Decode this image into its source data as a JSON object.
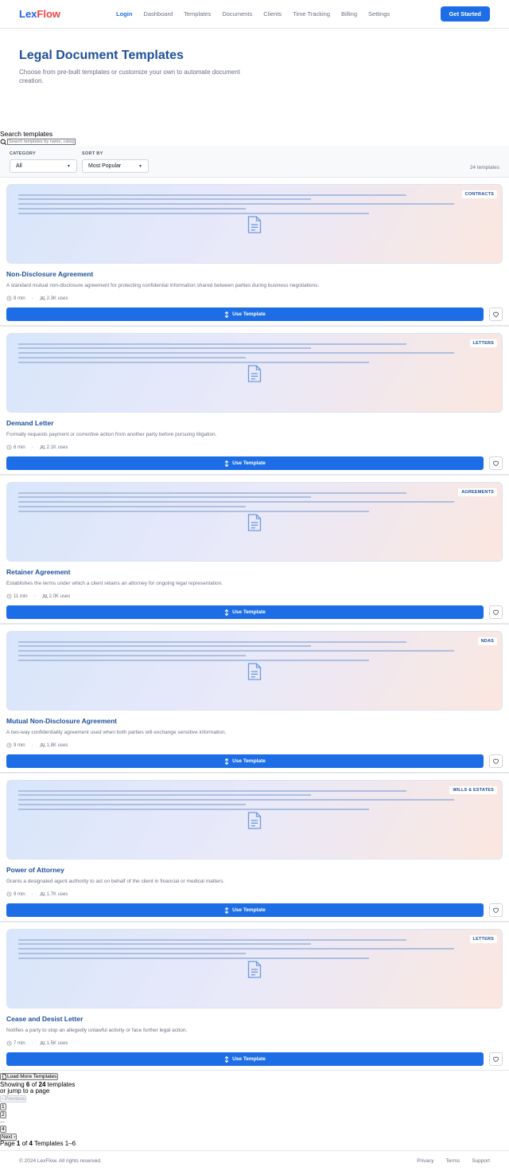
{
  "brand": {
    "part1": "Lex",
    "part2": "Flow"
  },
  "nav": {
    "items": [
      "Login",
      "Dashboard",
      "Templates",
      "Documents",
      "Clients",
      "Time Tracking",
      "Billing",
      "Settings"
    ],
    "cta": "Get Started"
  },
  "hero": {
    "title": "Legal Document Templates",
    "subtitle": "Choose from pre-built templates or customize your own to automate document creation."
  },
  "search": {
    "label": "Search templates",
    "placeholder": "Search templates by name, category, or keyword"
  },
  "filters": {
    "category_label": "CATEGORY",
    "category_value": "All",
    "sort_label": "SORT BY",
    "sort_value": "Most Popular",
    "count": "24 templates"
  },
  "templates": [
    {
      "tag": "CONTRACTS",
      "title": "Non-Disclosure Agreement",
      "desc": "A standard mutual non-disclosure agreement for protecting confidential information shared between parties during business negotiations.",
      "time": "8 min",
      "uses": "2.3K uses",
      "button": "Use Template"
    },
    {
      "tag": "LETTERS",
      "title": "Demand Letter",
      "desc": "Formally requests payment or corrective action from another party before pursuing litigation.",
      "time": "6 min",
      "uses": "2.1K uses",
      "button": "Use Template"
    },
    {
      "tag": "AGREEMENTS",
      "title": "Retainer Agreement",
      "desc": "Establishes the terms under which a client retains an attorney for ongoing legal representation.",
      "time": "11 min",
      "uses": "2.0K uses",
      "button": "Use Template"
    },
    {
      "tag": "NDAS",
      "title": "Mutual Non-Disclosure Agreement",
      "desc": "A two-way confidentiality agreement used when both parties will exchange sensitive information.",
      "time": "9 min",
      "uses": "1.8K uses",
      "button": "Use Template"
    },
    {
      "tag": "WILLS & ESTATES",
      "title": "Power of Attorney",
      "desc": "Grants a designated agent authority to act on behalf of the client in financial or medical matters.",
      "time": "9 min",
      "uses": "1.7K uses",
      "button": "Use Template"
    },
    {
      "tag": "LETTERS",
      "title": "Cease and Desist Letter",
      "desc": "Notifies a party to stop an allegedly unlawful activity or face further legal action.",
      "time": "7 min",
      "uses": "1.5K uses",
      "button": "Use Template"
    }
  ],
  "pagination": {
    "load_more": "Load More Templates",
    "showing_prefix": "Showing",
    "showing_count": "6",
    "of_word": "of",
    "total": "24",
    "templates_word": "templates",
    "jump_text": "or jump to a page",
    "previous": "Previous",
    "pages": [
      "1",
      "2",
      "...",
      "4"
    ],
    "next": "Next",
    "page_word": "Page",
    "current_page": "1",
    "total_pages": "4",
    "range_text": "Templates 1–6"
  },
  "footer": {
    "copyright": "© 2024 LexFlow. All rights reserved.",
    "links": [
      "Privacy",
      "Terms",
      "Support"
    ]
  }
}
